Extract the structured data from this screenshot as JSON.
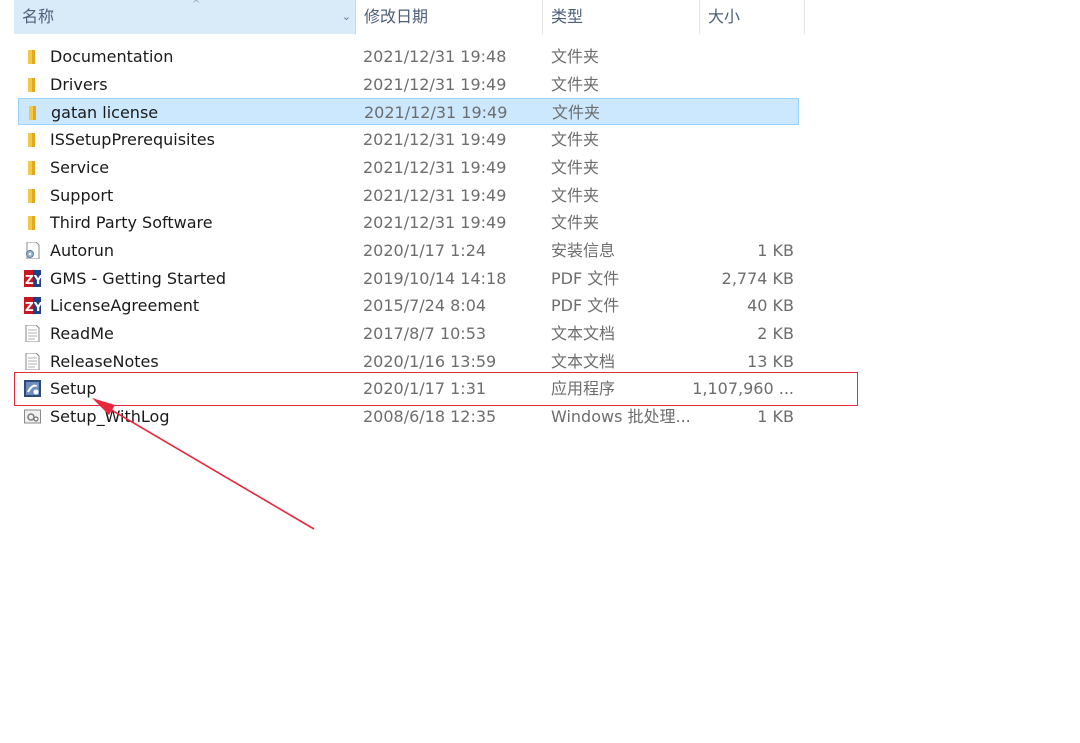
{
  "header": {
    "name": "名称",
    "date": "修改日期",
    "type": "类型",
    "size": "大小",
    "sort_indicator": "^",
    "dropdown_icon": "chevron-down-icon"
  },
  "files": [
    {
      "name": "Documentation",
      "date": "2021/12/31 19:48",
      "type": "文件夹",
      "size": "",
      "icon": "folder-icon"
    },
    {
      "name": "Drivers",
      "date": "2021/12/31 19:49",
      "type": "文件夹",
      "size": "",
      "icon": "folder-icon"
    },
    {
      "name": "gatan license",
      "date": "2021/12/31 19:49",
      "type": "文件夹",
      "size": "",
      "icon": "folder-icon",
      "selected": true
    },
    {
      "name": "ISSetupPrerequisites",
      "date": "2021/12/31 19:49",
      "type": "文件夹",
      "size": "",
      "icon": "folder-icon"
    },
    {
      "name": "Service",
      "date": "2021/12/31 19:49",
      "type": "文件夹",
      "size": "",
      "icon": "folder-icon"
    },
    {
      "name": "Support",
      "date": "2021/12/31 19:49",
      "type": "文件夹",
      "size": "",
      "icon": "folder-icon"
    },
    {
      "name": "Third Party Software",
      "date": "2021/12/31 19:49",
      "type": "文件夹",
      "size": "",
      "icon": "folder-icon"
    },
    {
      "name": "Autorun",
      "date": "2020/1/17 1:24",
      "type": "安装信息",
      "size": "1 KB",
      "icon": "setup-info-icon"
    },
    {
      "name": "GMS - Getting Started",
      "date": "2019/10/14 14:18",
      "type": "PDF 文件",
      "size": "2,774 KB",
      "icon": "pdf-icon"
    },
    {
      "name": "LicenseAgreement",
      "date": "2015/7/24 8:04",
      "type": "PDF 文件",
      "size": "40 KB",
      "icon": "pdf-icon"
    },
    {
      "name": "ReadMe",
      "date": "2017/8/7 10:53",
      "type": "文本文档",
      "size": "2 KB",
      "icon": "text-document-icon"
    },
    {
      "name": "ReleaseNotes",
      "date": "2020/1/16 13:59",
      "type": "文本文档",
      "size": "13 KB",
      "icon": "text-document-icon"
    },
    {
      "name": "Setup",
      "date": "2020/1/17 1:31",
      "type": "应用程序",
      "size": "1,107,960 ...",
      "icon": "setup-app-icon",
      "highlighted": true
    },
    {
      "name": "Setup_WithLog",
      "date": "2008/6/18 12:35",
      "type": "Windows 批处理...",
      "size": "1 KB",
      "icon": "batch-file-icon"
    }
  ],
  "pdf_icon_text": "ZY",
  "colors": {
    "selection_bg": "#cce8ff",
    "selection_border": "#99d1ff",
    "header_active_bg": "#d9ebf9",
    "annotation_red": "#e8283c",
    "folder_yellow": "#f4c94a",
    "pdf_red": "#c8171e",
    "pdf_blue": "#1e3f86"
  }
}
